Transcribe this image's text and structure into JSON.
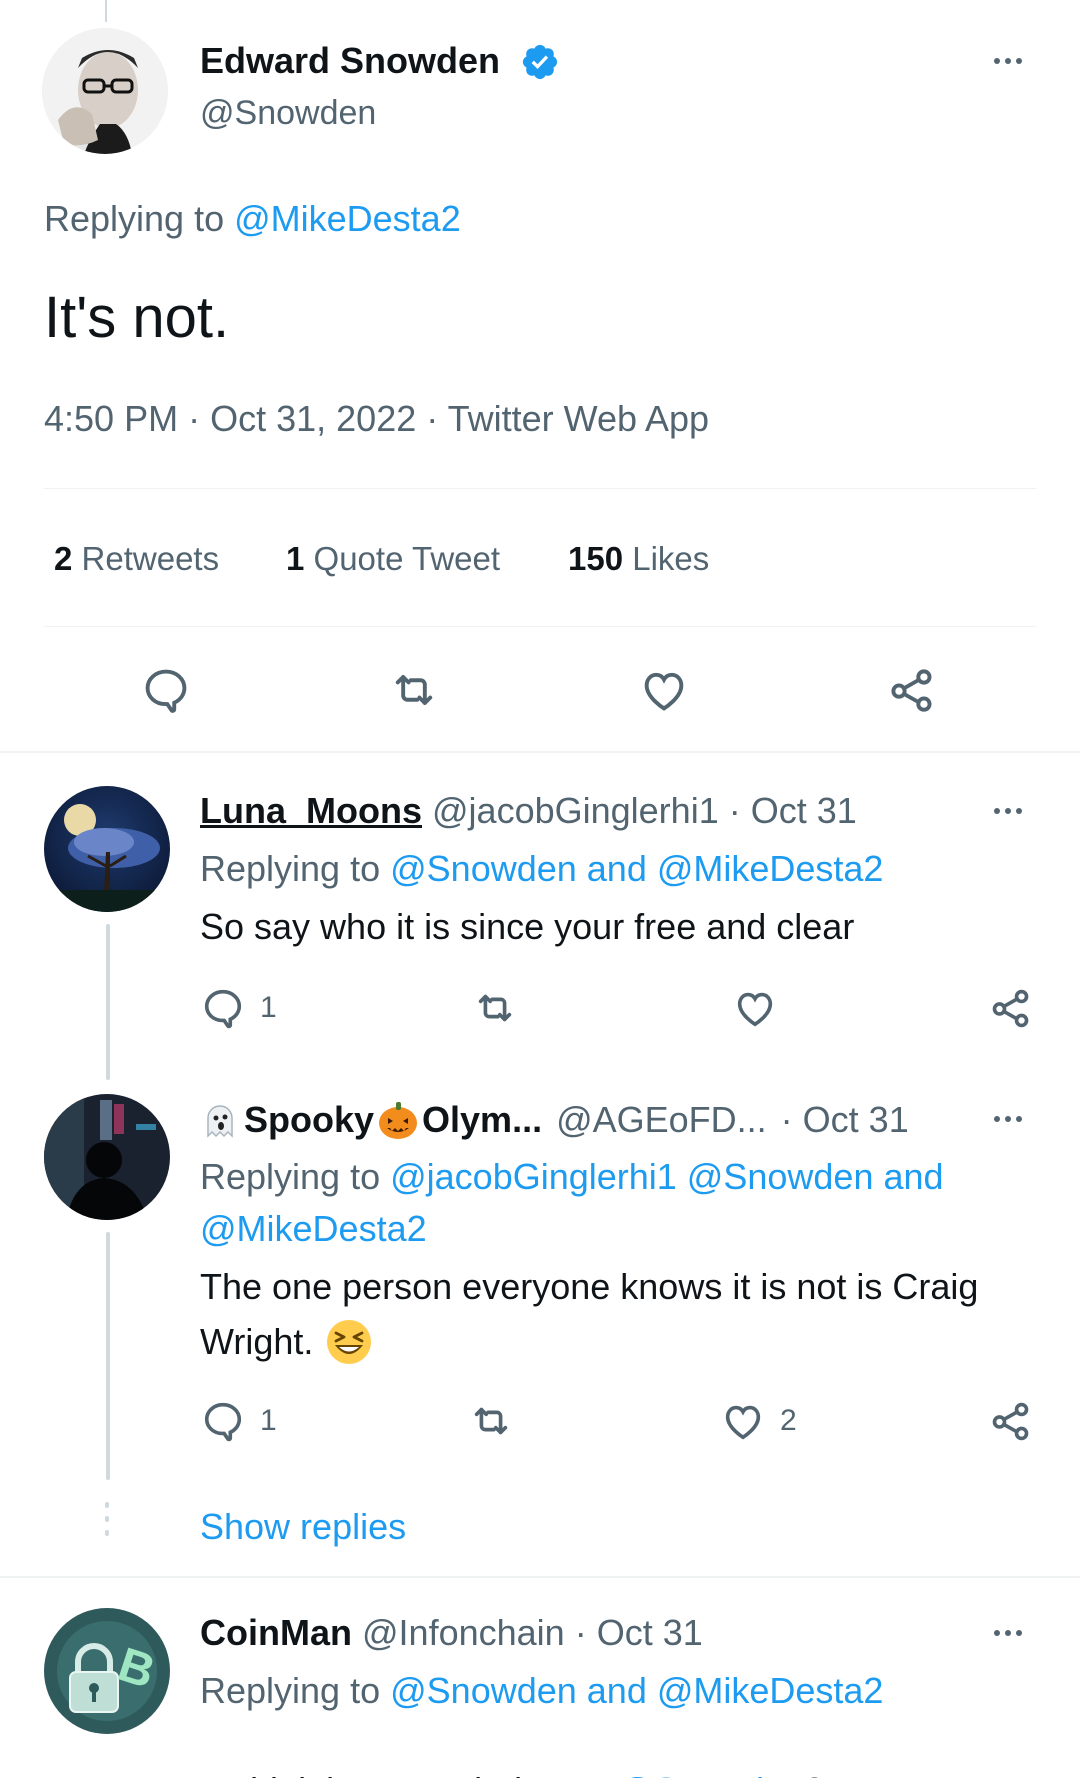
{
  "main_tweet": {
    "author_name": "Edward Snowden",
    "author_handle": "@Snowden",
    "replying_prefix": "Replying to ",
    "replying_to": "@MikeDesta2",
    "text": "It's not.",
    "time": "4:50 PM",
    "date": "Oct 31, 2022",
    "source": "Twitter Web App",
    "sep": "·",
    "retweets_count": "2",
    "retweets_label": "Retweets",
    "quotes_count": "1",
    "quotes_label": "Quote Tweet",
    "likes_count": "150",
    "likes_label": "Likes"
  },
  "replies": [
    {
      "author_name": "Luna_Moons",
      "author_handle": "@jacobGinglerhi1",
      "date": "Oct 31",
      "replying_prefix": "Replying to ",
      "replying_to": "@Snowden and @MikeDesta2",
      "text": "So say who it is since your free and clear",
      "reply_count": "1",
      "like_count": ""
    },
    {
      "author_name_a": "Spooky",
      "author_name_b": "Olym...",
      "author_handle": "@AGEoFD...",
      "date": "Oct 31",
      "replying_prefix": "Replying to ",
      "replying_to_line1": "@jacobGinglerhi1 @Snowden and",
      "replying_to_line2": "@MikeDesta2",
      "text_line1": "The one person everyone knows it is not is Craig",
      "text_line2": "Wright.",
      "reply_count": "1",
      "like_count": "2"
    },
    {
      "author_name": "CoinMan",
      "author_handle": "@Infonchain",
      "date": "Oct 31",
      "replying_prefix": "Replying to ",
      "replying_to": "@Snowden and @MikeDesta2",
      "text_prefix": "I think it was Hal Finney. ",
      "text_mention": "@Snowden",
      "text_suffix": "?"
    }
  ],
  "show_replies": "Show replies",
  "colors": {
    "accent": "#1d9bf0",
    "secondary": "#536471",
    "divider": "#eff3f4",
    "thread": "#cfd9de"
  },
  "icons": [
    "verified-badge-icon",
    "more-icon",
    "reply-icon",
    "retweet-icon",
    "like-icon",
    "share-icon",
    "ghost-emoji",
    "pumpkin-emoji",
    "laughing-emoji"
  ]
}
